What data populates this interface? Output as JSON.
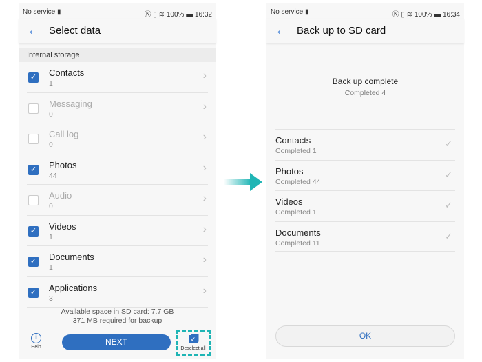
{
  "left": {
    "status": {
      "carrier": "No service",
      "battery": "100%",
      "time": "16:32"
    },
    "title": "Select data",
    "section": "Internal storage",
    "items": [
      {
        "name": "Contacts",
        "count": "1",
        "checked": true
      },
      {
        "name": "Messaging",
        "count": "0",
        "checked": false
      },
      {
        "name": "Call log",
        "count": "0",
        "checked": false
      },
      {
        "name": "Photos",
        "count": "44",
        "checked": true
      },
      {
        "name": "Audio",
        "count": "0",
        "checked": false
      },
      {
        "name": "Videos",
        "count": "1",
        "checked": true
      },
      {
        "name": "Documents",
        "count": "1",
        "checked": true
      },
      {
        "name": "Applications",
        "count": "3",
        "checked": true
      }
    ],
    "available": "Available space in SD card: 7.7 GB",
    "required": "371 MB required for backup",
    "help": "Help",
    "next": "NEXT",
    "deselect": "Deselect all"
  },
  "right": {
    "status": {
      "carrier": "No service",
      "battery": "100%",
      "time": "16:34"
    },
    "title": "Back up to SD card",
    "complete": "Back up complete",
    "completed": "Completed 4",
    "items": [
      {
        "name": "Contacts",
        "sub": "Completed 1"
      },
      {
        "name": "Photos",
        "sub": "Completed 44"
      },
      {
        "name": "Videos",
        "sub": "Completed 1"
      },
      {
        "name": "Documents",
        "sub": "Completed 11"
      }
    ],
    "ok": "OK"
  },
  "colors": {
    "accent": "#2f6fc0",
    "highlight": "#1fb5b5"
  }
}
